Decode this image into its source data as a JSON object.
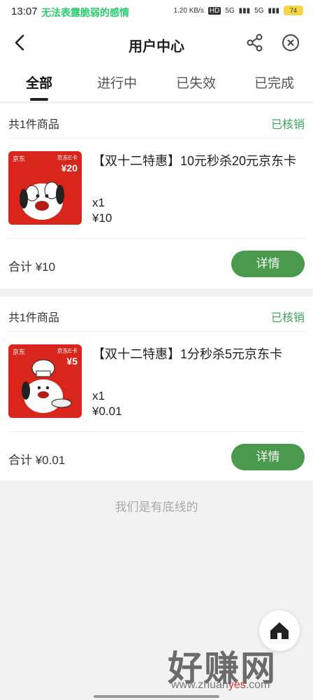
{
  "status_bar": {
    "time": "13:07",
    "marquee": "无法表露脆弱的感情",
    "speed": "1.20 KB/s",
    "hd": "HD",
    "network1": "5G",
    "network2": "5G",
    "battery": "74"
  },
  "header": {
    "title": "用户中心",
    "back_icon": "chevron-left-icon",
    "share_icon": "share-icon",
    "close_icon": "close-circle-icon"
  },
  "tabs": [
    {
      "label": "全部",
      "active": true
    },
    {
      "label": "进行中",
      "active": false
    },
    {
      "label": "已失效",
      "active": false
    },
    {
      "label": "已完成",
      "active": false
    }
  ],
  "orders": [
    {
      "count_label": "共1件商品",
      "status": "已核销",
      "thumb_brand": "京东",
      "thumb_card": "京东E卡",
      "thumb_value": "¥20",
      "title": "【双十二特惠】10元秒杀20元京东卡",
      "qty": "x1",
      "price": "¥10",
      "total": "合计 ¥10",
      "detail_label": "详情"
    },
    {
      "count_label": "共1件商品",
      "status": "已核销",
      "thumb_brand": "京东",
      "thumb_card": "京东E卡",
      "thumb_value": "¥5",
      "title": "【双十二特惠】1分秒杀5元京东卡",
      "qty": "x1",
      "price": "¥0.01",
      "total": "合计 ¥0.01",
      "detail_label": "详情"
    }
  ],
  "footer_note": "我们是有底线的",
  "home_icon": "home-icon",
  "watermark": {
    "cn": "好赚网",
    "url_pre": "www.zhuan",
    "url_hl": "yes",
    "url_post": ".com"
  },
  "colors": {
    "accent_green": "#4a9a4d",
    "status_green": "#3ea55a",
    "jd_red": "#d9261c"
  }
}
